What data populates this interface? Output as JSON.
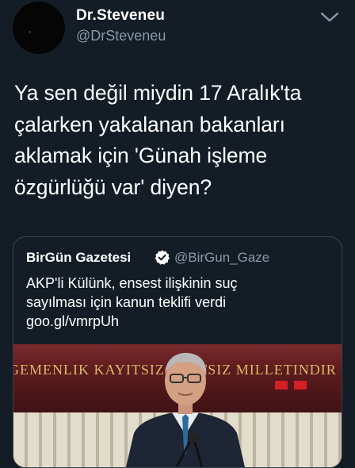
{
  "tweet": {
    "display_name": "Dr.Steveneu",
    "handle": "@DrSteveneu",
    "text": "Ya sen değil miydin 17 Aralık'ta\nçalarken yakalanan bakanları\naklamak için 'Günah işleme\nözgürlüğü var' diyen?"
  },
  "quote": {
    "name": "BirGün Gazetesi",
    "handle": "@BirGun_Gaze",
    "text": "AKP'li Külünk, ensest ilişkinin suç\nsayılması için kanun teklifi verdi\ngoo.gl/vmrpUh",
    "media_banner_text": "GEMENLIK KAYITSIZ ŞARTSIZ MILLETINDIR"
  },
  "icons": {
    "menu": "chevron-down-icon",
    "verified": "verified-badge-icon"
  },
  "colors": {
    "background": "#141d26",
    "secondary_text": "#8899a6",
    "card_border": "#38444d"
  }
}
